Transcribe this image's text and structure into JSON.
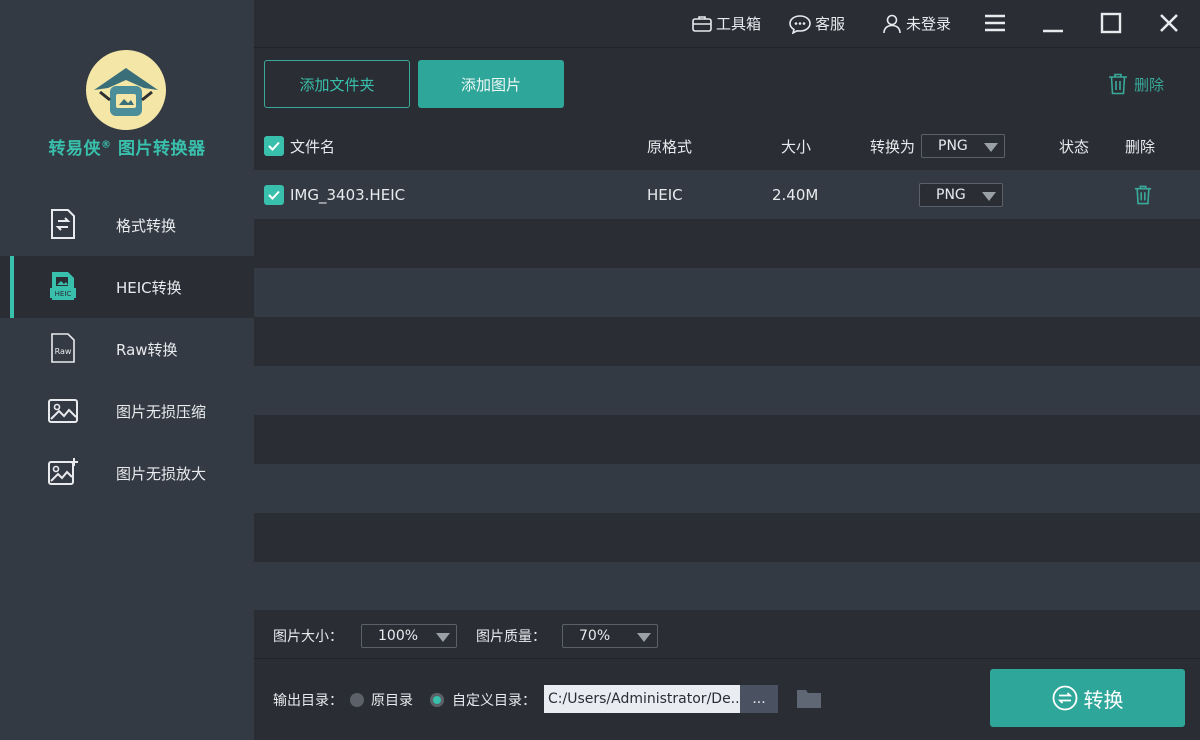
{
  "sidebar": {
    "brand_name": "转易侠",
    "brand_mark": "®",
    "brand_suffix": "图片转换器",
    "items": [
      {
        "label": "格式转换",
        "icon": "format-convert-icon"
      },
      {
        "label": "HEIC转换",
        "icon": "heic-icon",
        "badge": "HEIC",
        "active": true
      },
      {
        "label": "Raw转换",
        "icon": "raw-file-icon",
        "badge": "Raw"
      },
      {
        "label": "图片无损压缩",
        "icon": "image-compress-icon"
      },
      {
        "label": "图片无损放大",
        "icon": "image-enlarge-icon"
      }
    ]
  },
  "topbar": {
    "toolbox": "工具箱",
    "service": "客服",
    "login": "未登录"
  },
  "actions": {
    "add_folder": "添加文件夹",
    "add_image": "添加图片",
    "delete": "删除"
  },
  "table": {
    "headers": {
      "filename": "文件名",
      "source_format": "原格式",
      "size": "大小",
      "convert_to": "转换为",
      "convert_to_value": "PNG",
      "status": "状态",
      "delete": "删除"
    },
    "rows": [
      {
        "filename": "IMG_3403.HEIC",
        "format": "HEIC",
        "size": "2.40M",
        "target": "PNG",
        "checked": true
      }
    ]
  },
  "settings": {
    "image_size_label": "图片大小：",
    "image_size_value": "100%",
    "quality_label": "图片质量：",
    "quality_value": "70%"
  },
  "output": {
    "label": "输出目录：",
    "option_original": "原目录",
    "option_custom": "自定义目录：",
    "selected": "custom",
    "path": "C:/Users/Administrator/De...",
    "browse": "...",
    "convert": "转换"
  },
  "colors": {
    "accent": "#39c0ac",
    "button": "#2fa69a",
    "sidebar_bg": "#343a44",
    "main_bg": "#2a2d33"
  }
}
